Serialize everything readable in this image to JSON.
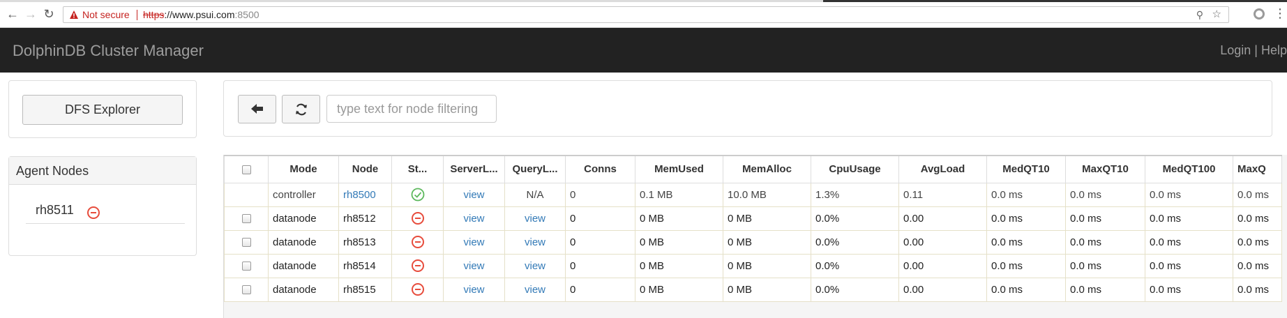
{
  "browser": {
    "not_secure": "Not secure",
    "url_scheme": "https",
    "url_host": "://www.psui.com",
    "url_port": ":8500"
  },
  "navbar": {
    "brand": "DolphinDB Cluster Manager",
    "login": "Login",
    "separator": " | ",
    "help": "Help"
  },
  "dfs": {
    "button_label": "DFS Explorer"
  },
  "agents": {
    "title": "Agent Nodes",
    "items": [
      {
        "name": "rh8511",
        "status": "stopped"
      }
    ]
  },
  "toolbar": {
    "filter_placeholder": "type text for node filtering"
  },
  "table": {
    "headers": [
      "Mode",
      "Node",
      "St...",
      "ServerL...",
      "QueryL...",
      "Conns",
      "MemUsed",
      "MemAlloc",
      "CpuUsage",
      "AvgLoad",
      "MedQT10",
      "MaxQT10",
      "MedQT100",
      "MaxQ"
    ],
    "rows": [
      {
        "mode": "controller",
        "node": "rh8500",
        "status": "running",
        "server_log": "view",
        "query_log": "N/A",
        "conns": "0",
        "mem_used": "0.1 MB",
        "mem_alloc": "10.0 MB",
        "cpu": "1.3%",
        "avg_load": "0.11",
        "med_qt10": "0.0 ms",
        "max_qt10": "0.0 ms",
        "med_qt100": "0.0 ms",
        "max_qt100": "0.0 ms"
      },
      {
        "mode": "datanode",
        "node": "rh8512",
        "status": "stopped",
        "server_log": "view",
        "query_log": "view",
        "conns": "0",
        "mem_used": "0 MB",
        "mem_alloc": "0 MB",
        "cpu": "0.0%",
        "avg_load": "0.00",
        "med_qt10": "0.0 ms",
        "max_qt10": "0.0 ms",
        "med_qt100": "0.0 ms",
        "max_qt100": "0.0 ms"
      },
      {
        "mode": "datanode",
        "node": "rh8513",
        "status": "stopped",
        "server_log": "view",
        "query_log": "view",
        "conns": "0",
        "mem_used": "0 MB",
        "mem_alloc": "0 MB",
        "cpu": "0.0%",
        "avg_load": "0.00",
        "med_qt10": "0.0 ms",
        "max_qt10": "0.0 ms",
        "med_qt100": "0.0 ms",
        "max_qt100": "0.0 ms"
      },
      {
        "mode": "datanode",
        "node": "rh8514",
        "status": "stopped",
        "server_log": "view",
        "query_log": "view",
        "conns": "0",
        "mem_used": "0 MB",
        "mem_alloc": "0 MB",
        "cpu": "0.0%",
        "avg_load": "0.00",
        "med_qt10": "0.0 ms",
        "max_qt10": "0.0 ms",
        "med_qt100": "0.0 ms",
        "max_qt100": "0.0 ms"
      },
      {
        "mode": "datanode",
        "node": "rh8515",
        "status": "stopped",
        "server_log": "view",
        "query_log": "view",
        "conns": "0",
        "mem_used": "0 MB",
        "mem_alloc": "0 MB",
        "cpu": "0.0%",
        "avg_load": "0.00",
        "med_qt10": "0.0 ms",
        "max_qt10": "0.0 ms",
        "med_qt100": "0.0 ms",
        "max_qt100": "0.0 ms"
      }
    ]
  },
  "icons": {
    "running": "check-circle-icon",
    "stopped": "minus-circle-icon"
  },
  "colors": {
    "navbar_bg": "#222222",
    "link": "#337ab7",
    "running": "#5cb85c",
    "stopped": "#e74c3c"
  }
}
